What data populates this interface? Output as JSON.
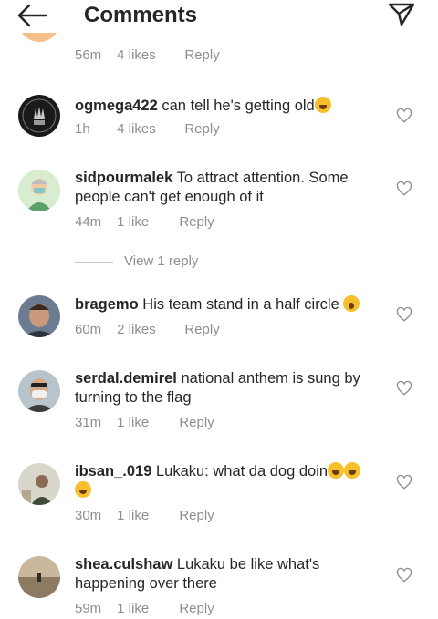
{
  "header": {
    "title": "Comments",
    "back_icon": "arrow-left-icon",
    "send_icon": "paper-plane-icon"
  },
  "colors": {
    "text": "#262626",
    "meta": "#8e8e8e",
    "background": "#ffffff"
  },
  "top_partial": {
    "time": "56m",
    "likes": "4 likes",
    "reply": "Reply"
  },
  "comments": [
    {
      "username": "ogmega422",
      "text": " can tell he's getting old",
      "emoji": "😂",
      "time": "1h",
      "likes": "4 likes",
      "reply": "Reply"
    },
    {
      "username": "sidpourmalek",
      "text": " To attract attention. Some people can't get enough of it",
      "time": "44m",
      "likes": "1 like",
      "reply": "Reply"
    },
    {
      "username": "bragemo",
      "text": " His team stand in a half circle ",
      "emoji": "😮",
      "time": "60m",
      "likes": "2 likes",
      "reply": "Reply"
    },
    {
      "username": "serdal.demirel",
      "text": " national anthem is sung by turning to the flag",
      "time": "31m",
      "likes": "1 like",
      "reply": "Reply"
    },
    {
      "username": "ibsan_.019",
      "text": " Lukaku: what da dog doin",
      "emoji": "🤣🤣🤣",
      "time": "30m",
      "likes": "1 like",
      "reply": "Reply"
    },
    {
      "username": "shea.culshaw",
      "text": " Lukaku be like what's happening over there",
      "time": "59m",
      "likes": "1 like",
      "reply": "Reply"
    }
  ],
  "view_replies": "View 1 reply"
}
